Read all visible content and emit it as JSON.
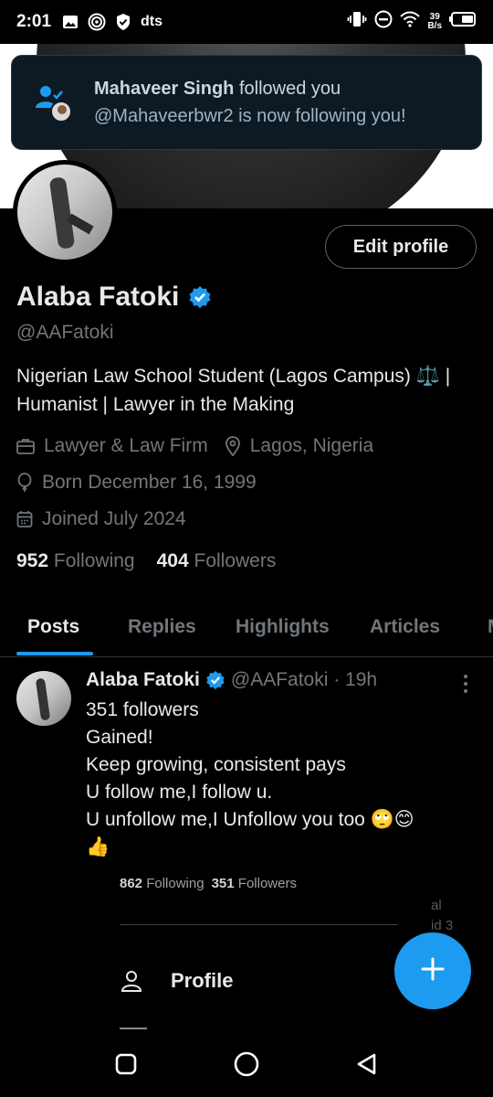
{
  "status_bar": {
    "time": "2:01",
    "carrier_label": "dts",
    "net_speed_value": "39",
    "net_speed_unit": "B/s"
  },
  "notification": {
    "name": "Mahaveer Singh",
    "action": " followed you",
    "subtitle": "@Mahaveerbwr2 is now following you!"
  },
  "profile": {
    "edit_label": "Edit profile",
    "name": "Alaba Fatoki",
    "handle": "@AAFatoki",
    "bio": "Nigerian Law School Student (Lagos Campus) ⚖️ | Humanist | Lawyer in the Making",
    "category": "Lawyer & Law Firm",
    "location": "Lagos, Nigeria",
    "born": "Born December 16, 1999",
    "joined": "Joined July 2024",
    "following_count": "952",
    "following_label": "Following",
    "followers_count": "404",
    "followers_label": "Followers"
  },
  "tabs": [
    {
      "label": "Posts"
    },
    {
      "label": "Replies"
    },
    {
      "label": "Highlights"
    },
    {
      "label": "Articles"
    },
    {
      "label": "M"
    }
  ],
  "post": {
    "name": "Alaba Fatoki",
    "handle_time": "@AAFatoki · 19h",
    "body": "351 followers\nGained!\nKeep growing, consistent pays\nU follow me,I follow u.\nU unfollow me,I Unfollow you too 🙄😊\n👍",
    "embed": {
      "following_count": "862",
      "following_label": "Following",
      "followers_count": "351",
      "followers_label": "Followers",
      "faded_line1": "al",
      "faded_line2": "id 3",
      "menu_item": "Profile"
    }
  },
  "icons": {
    "notification": "follow-user-icon",
    "verified": "verified-badge-icon",
    "category": "briefcase-icon",
    "location": "map-pin-icon",
    "born": "balloon-icon",
    "joined": "calendar-icon",
    "compose": "plus-icon"
  },
  "colors": {
    "accent": "#1d9bf0",
    "background": "#000000",
    "muted_text": "#71767b"
  }
}
